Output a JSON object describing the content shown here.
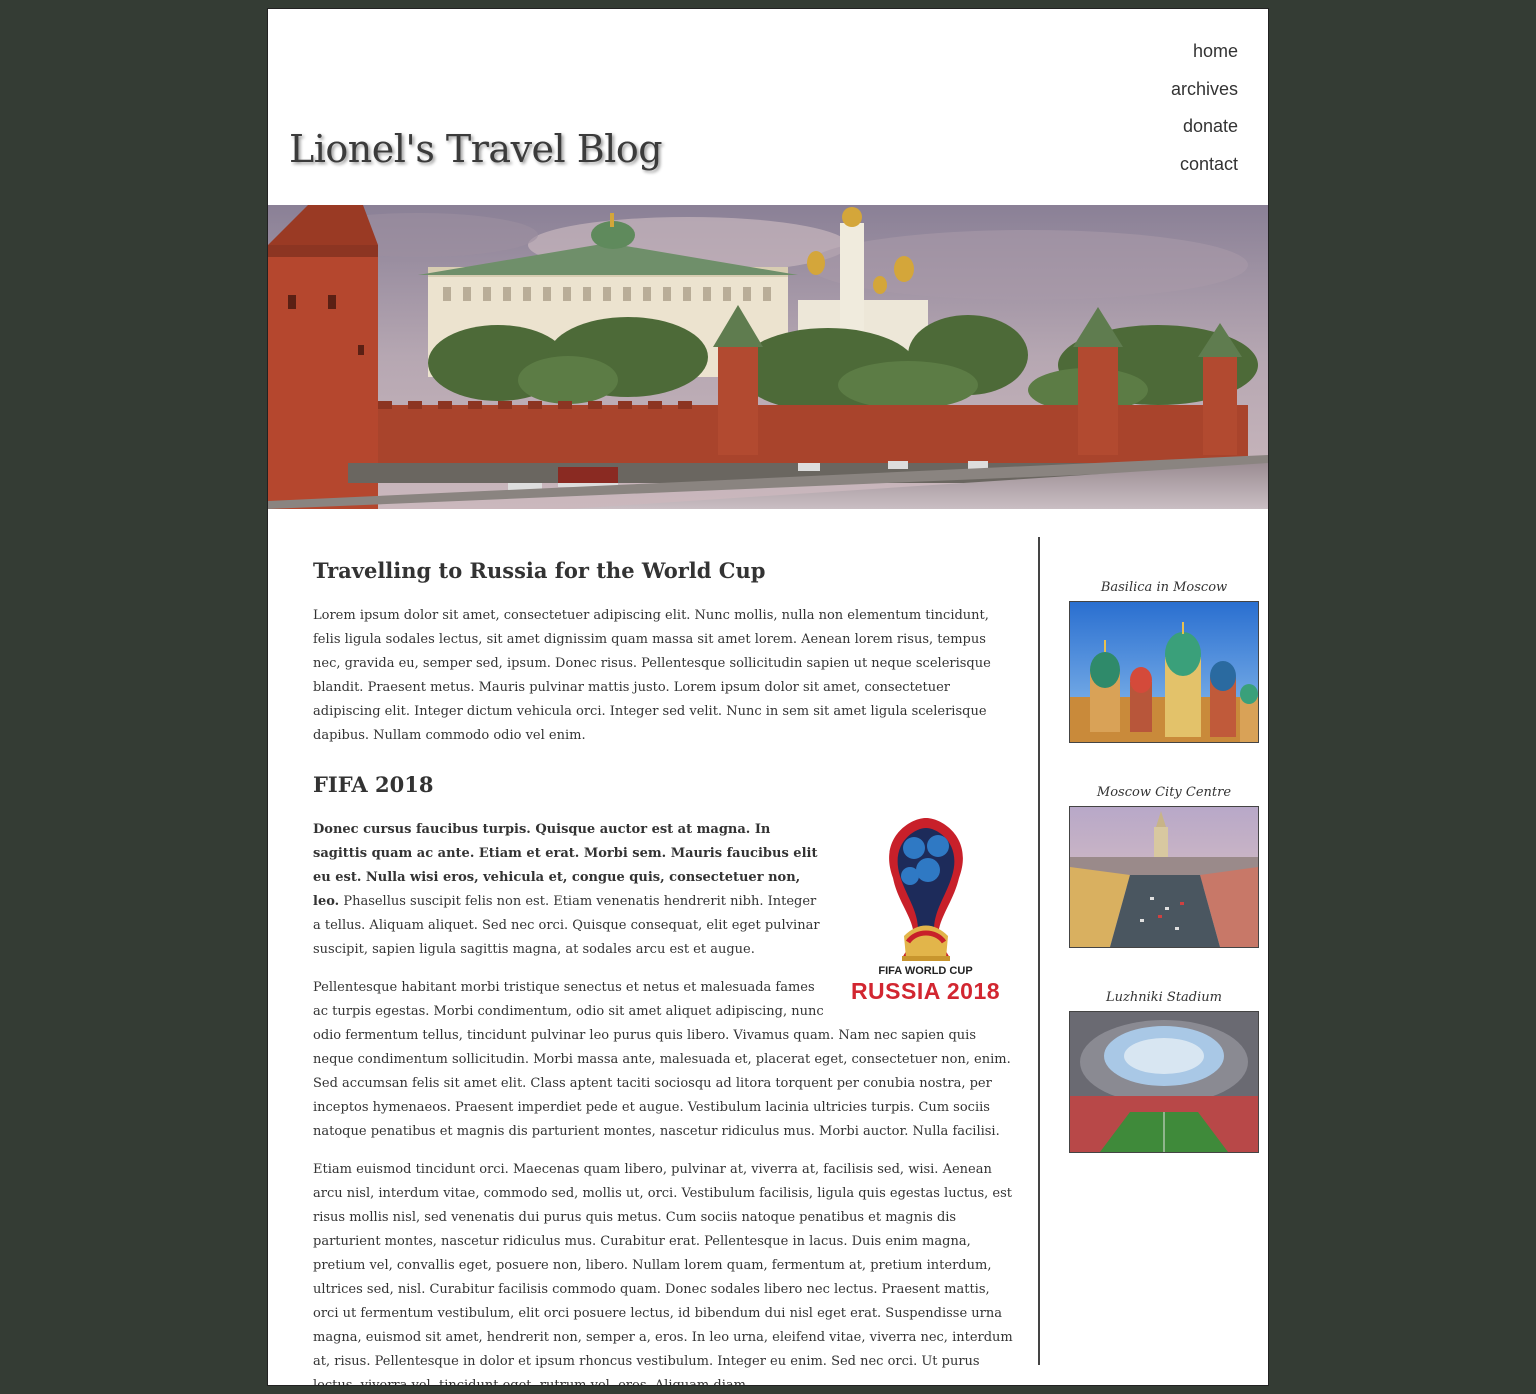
{
  "site": {
    "title": "Lionel's Travel Blog"
  },
  "nav": [
    "home",
    "archives",
    "donate",
    "contact"
  ],
  "article": {
    "title": "Travelling to Russia for the World Cup",
    "intro": "Lorem ipsum dolor sit amet, consectetuer adipiscing elit. Nunc mollis, nulla non elementum tincidunt, felis ligula sodales lectus, sit amet dignissim quam massa sit amet lorem. Aenean lorem risus, tempus nec, gravida eu, semper sed, ipsum. Donec risus. Pellentesque sollicitudin sapien ut neque scelerisque blandit. Praesent metus. Mauris pulvinar mattis justo. Lorem ipsum dolor sit amet, consectetuer adipiscing elit. Integer dictum vehicula orci. Integer sed velit. Nunc in sem sit amet ligula scelerisque dapibus. Nullam commodo odio vel enim.",
    "subheading": "FIFA 2018",
    "bold_lead": "Donec cursus faucibus turpis. Quisque auctor est at magna. In sagittis quam ac ante. Etiam et erat. Morbi sem. Mauris faucibus elit eu est. Nulla wisi eros, vehicula et, congue quis, consectetuer non, leo.",
    "para2_rest": " Phasellus suscipit felis non est. Etiam venenatis hendrerit nibh. Integer a tellus. Aliquam aliquet. Sed nec orci. Quisque consequat, elit eget pulvinar suscipit, sapien ligula sagittis magna, at sodales arcu est et augue.",
    "para3": "Pellentesque habitant morbi tristique senectus et netus et malesuada fames ac turpis egestas. Morbi condimentum, odio sit amet aliquet adipiscing, nunc odio fermentum tellus, tincidunt pulvinar leo purus quis libero. Vivamus quam. Nam nec sapien quis neque condimentum sollicitudin. Morbi massa ante, malesuada et, placerat eget, consectetuer non, enim. Sed accumsan felis sit amet elit. Class aptent taciti sociosqu ad litora torquent per conubia nostra, per inceptos hymenaeos. Praesent imperdiet pede et augue. Vestibulum lacinia ultricies turpis. Cum sociis natoque penatibus et magnis dis parturient montes, nascetur ridiculus mus. Morbi auctor. Nulla facilisi.",
    "para4": "Etiam euismod tincidunt orci. Maecenas quam libero, pulvinar at, viverra at, facilisis sed, wisi. Aenean arcu nisl, interdum vitae, commodo sed, mollis ut, orci. Vestibulum facilisis, ligula quis egestas luctus, est risus mollis nisl, sed venenatis dui purus quis metus. Cum sociis natoque penatibus et magnis dis parturient montes, nascetur ridiculus mus. Curabitur erat. Pellentesque in lacus. Duis enim magna, pretium vel, convallis eget, posuere non, libero. Nullam lorem quam, fermentum at, pretium interdum, ultrices sed, nisl. Curabitur facilisis commodo quam. Donec sodales libero nec lectus. Praesent mattis, orci ut fermentum vestibulum, elit orci posuere lectus, id bibendum dui nisl eget erat. Suspendisse urna magna, euismod sit amet, hendrerit non, semper a, eros. In leo urna, eleifend vitae, viverra nec, interdum at, risus. Pellentesque in dolor et ipsum rhoncus vestibulum. Integer eu enim. Sed nec orci. Ut purus lectus, viverra vel, tincidunt eget, rutrum vel, eros. Aliquam diam.",
    "logo": {
      "line1": "FIFA WORLD CUP",
      "line2": "RUSSIA 2018"
    }
  },
  "sidebar": [
    {
      "caption": "Basilica in Moscow"
    },
    {
      "caption": "Moscow City Centre"
    },
    {
      "caption": "Luzhniki Stadium"
    }
  ],
  "colors": {
    "background": "#343c34",
    "page": "#ffffff",
    "text": "#333333",
    "kremlin_red": "#b5472e",
    "logo_red": "#d22630"
  }
}
